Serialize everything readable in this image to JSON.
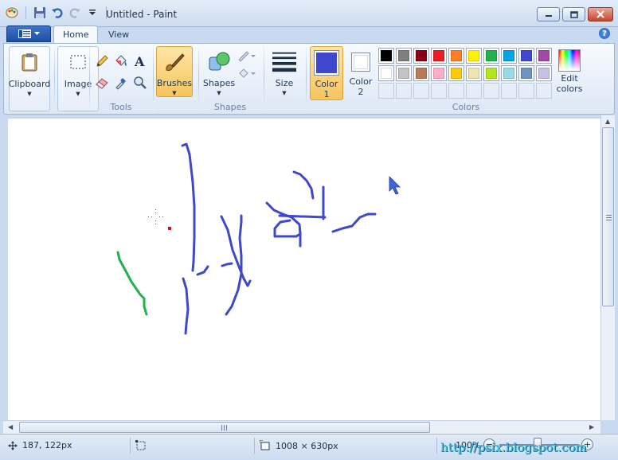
{
  "window": {
    "title": "Untitled - Paint"
  },
  "tabs": [
    {
      "label": "Home"
    },
    {
      "label": "View"
    }
  ],
  "help": {
    "label": "?"
  },
  "ribbon": {
    "clipboard": {
      "label": "Clipboard"
    },
    "image": {
      "label": "Image"
    },
    "tools": {
      "group_label": "Tools"
    },
    "brushes": {
      "label": "Brushes"
    },
    "shapes": {
      "label": "Shapes",
      "group_label": "Shapes"
    },
    "size": {
      "label": "Size"
    },
    "color1": {
      "label_line1": "Color",
      "label_line2": "1",
      "value": "#3f48cc"
    },
    "color2": {
      "label_line1": "Color",
      "label_line2": "2",
      "value": "#ffffff"
    },
    "colors": {
      "group_label": "Colors",
      "row1": [
        "#000000",
        "#7f7f7f",
        "#880015",
        "#ed1c24",
        "#ff7f27",
        "#fff200",
        "#22b14c",
        "#00a2e8",
        "#3f48cc",
        "#a349a4"
      ],
      "row2": [
        "#ffffff",
        "#c3c3c3",
        "#b97a57",
        "#ffaec9",
        "#ffc90e",
        "#efe4b0",
        "#b5e61d",
        "#99d9ea",
        "#7092be",
        "#c8bfe7"
      ]
    },
    "edit_colors": {
      "label_line1": "Edit",
      "label_line2": "colors"
    }
  },
  "statusbar": {
    "cursor_position": "187, 122px",
    "canvas_size": "1008 × 630px",
    "zoom": "100%"
  },
  "watermark": "http://psix.blogspot.com"
}
